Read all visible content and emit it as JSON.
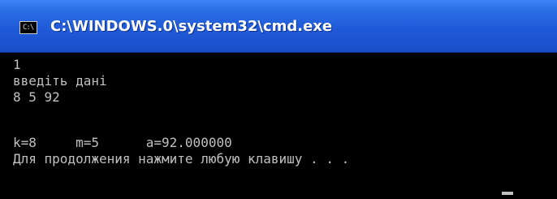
{
  "window": {
    "title": "C:\\WINDOWS.0\\system32\\cmd.exe",
    "icon_glyph": "C:\\",
    "icon_name": "cmd-console-icon",
    "colors": {
      "titlebar": "#2363de",
      "console_background": "#000000",
      "console_text": "#c0c0c0"
    }
  },
  "console": {
    "lines": [
      "1",
      "введіть дані",
      "8 5 92",
      "",
      "k=8     m=5      a=92.000000",
      "Для продолжения нажмите любую клавишу . . ."
    ]
  }
}
